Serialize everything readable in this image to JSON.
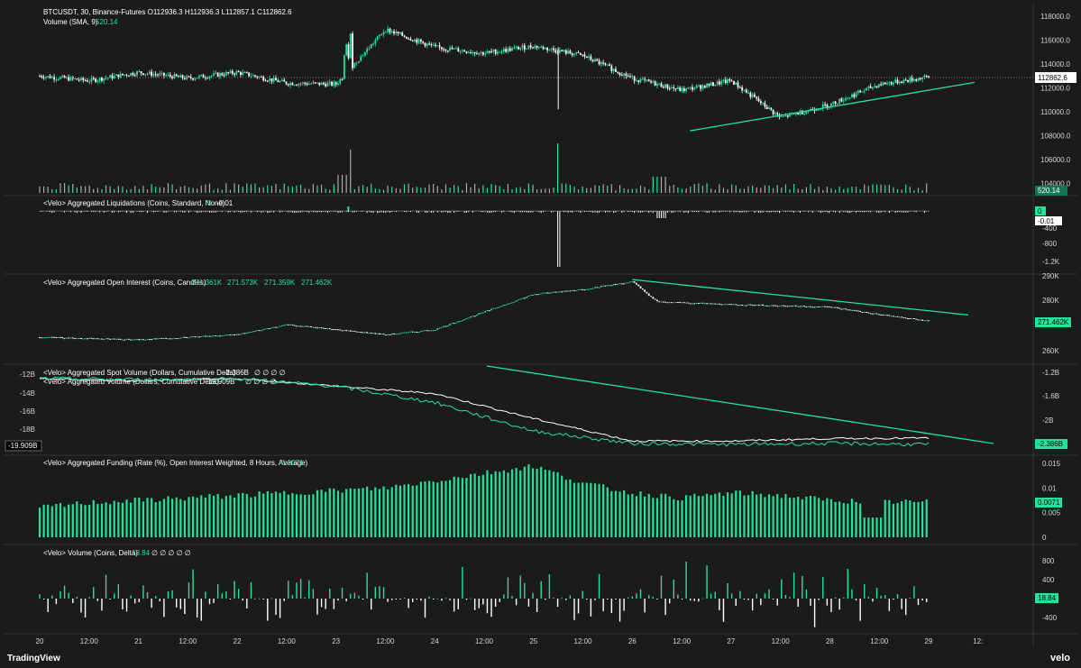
{
  "colors": {
    "bg": "#1b1b1b",
    "up": "#22e39a",
    "down": "#ffffff",
    "grid": "#2a2a2a",
    "text": "#d1d4dc",
    "accent": "#22e39a",
    "dark_badge": "#000000"
  },
  "price_panel": {
    "header": "BTCUSDT, 30, Binance-Futures",
    "ohlc": "O112936.3  H112936.3  L112857.1  C112862.6",
    "volume_label": "Volume (SMA, 9)",
    "volume_value": "520.14",
    "last_price": "112862.6"
  },
  "liq_panel": {
    "title": "<Velo> Aggregated Liquidations (Coins, Standard, None)",
    "v1": "0",
    "v2": "-0.01",
    "badge_top": "0",
    "badge_bottom": "-0.01"
  },
  "oi_panel": {
    "title": "<Velo> Aggregated Open Interest (Coins, Candles)",
    "v1": "271.361K",
    "v2": "271.573K",
    "v3": "271.359K",
    "v4": "271.462K",
    "badge": "271.462K"
  },
  "cvd_panel": {
    "spot_title": "<Velo> Aggregated Spot Volume (Dollars, Cumulative Delta)",
    "spot_value": "-2.386B",
    "perp_title": "<Velo> Aggregated Volume (Dollars, Cumulative Delta)",
    "perp_value": "-19.909B",
    "null_marks": "∅ ∅ ∅ ∅",
    "left_badge": "-19.909B",
    "right_badge": "-2.386B"
  },
  "funding_panel": {
    "title": "<Velo> Aggregated Funding (Rate (%), Open Interest Weighted, 8 Hours, Average)",
    "value": "0.0071",
    "badge": "0.0071"
  },
  "delta_panel": {
    "title": "<Velo> Volume (Coins, Delta)",
    "value": "18.84",
    "null_marks": "∅ ∅ ∅ ∅ ∅",
    "badge": "18.84"
  },
  "branding": {
    "tv": "TradingView",
    "velo": "velo"
  },
  "chart_data": [
    {
      "type": "candlestick",
      "title": "BTCUSDT, 30, Binance-Futures",
      "y_ticks": [
        "118000.0",
        "116000.0",
        "114000.0",
        "112000.0",
        "110000.0",
        "108000.0",
        "106000.0",
        "104000.0"
      ],
      "ylim": [
        103500,
        118600
      ],
      "x_ticks": [
        "20",
        "12:00",
        "21",
        "12:00",
        "22",
        "12:00",
        "23",
        "12:00",
        "24",
        "12:00",
        "25",
        "12:00",
        "26",
        "12:00",
        "27",
        "12:00",
        "28",
        "12:00",
        "29",
        "12:"
      ],
      "x": [
        0,
        12,
        24,
        36,
        48,
        60,
        72,
        84,
        96,
        108,
        120,
        132,
        144,
        156,
        168,
        180,
        192,
        204,
        216
      ],
      "close": [
        113000,
        112600,
        113300,
        112800,
        113300,
        112400,
        112300,
        116900,
        115400,
        114900,
        115500,
        114700,
        112800,
        111800,
        112600,
        109500,
        110600,
        112300,
        112900
      ],
      "trendline": [
        [
          158,
          108400
        ],
        [
          214,
          112000
        ]
      ],
      "last": 112862.6
    },
    {
      "type": "bar",
      "title": "Volume (SMA, 9)",
      "spikes": [
        {
          "x": 75,
          "value": "large"
        },
        {
          "x": 126,
          "value": "largest"
        }
      ],
      "last": 520.14
    },
    {
      "type": "bar",
      "title": "<Velo> Aggregated Liquidations (Coins, Standard, None)",
      "y_ticks": [
        "-400",
        "-800",
        "-1.2K"
      ],
      "spikes": [
        {
          "x": 126,
          "value": -1300
        },
        {
          "x": 150,
          "value": -200
        }
      ]
    },
    {
      "type": "line",
      "title": "<Velo> Aggregated Open Interest (Coins, Candles)",
      "y_ticks": [
        "290K",
        "280K",
        "260K"
      ],
      "x": [
        0,
        24,
        48,
        60,
        72,
        84,
        96,
        108,
        120,
        132,
        144,
        150,
        168,
        192,
        204,
        216
      ],
      "values": [
        265000,
        264000,
        266000,
        270000,
        268000,
        266000,
        268000,
        275000,
        282000,
        284000,
        287000,
        279000,
        278000,
        277000,
        274000,
        271400
      ],
      "trendline": [
        [
          144,
          287800
        ],
        [
          222,
          273800
        ]
      ],
      "last": 271462
    }
  ],
  "chart_data_extra": [
    {
      "type": "line",
      "title": "Cumulative Delta",
      "y_ticks_left": [
        "-12B",
        "-14B",
        "-16B",
        "-18B"
      ],
      "y_ticks_right": [
        "-1.2B",
        "-1.6B",
        "-2B"
      ],
      "series": [
        {
          "name": "<Velo> Aggregated Spot Volume (Dollars, Cumulative Delta)",
          "values": [
            -1.2,
            -1.25,
            -1.2,
            -1.35,
            -1.5,
            -2.0,
            -2.45,
            -2.45,
            -2.4,
            -2.39
          ]
        },
        {
          "name": "<Velo> Aggregated Volume (Dollars, Cumulative Delta)",
          "values": [
            -13,
            -13.1,
            -13.0,
            -13.8,
            -15.5,
            -18.5,
            -19.8,
            -19.9,
            -19.8,
            -19.9
          ]
        }
      ],
      "trendline": "descending"
    },
    {
      "type": "bar",
      "title": "<Velo> Aggregated Funding (Rate (%), Open Interest Weighted, 8 Hours, Average)",
      "y_ticks": [
        "0.015",
        "0.01",
        "0.005",
        "0"
      ],
      "values": [
        0.006,
        0.007,
        0.0075,
        0.008,
        0.0085,
        0.009,
        0.0095,
        0.01,
        0.0115,
        0.013,
        0.0145,
        0.011,
        0.009,
        0.008,
        0.009,
        0.0085,
        0.0075,
        0.0072,
        0.0071
      ]
    },
    {
      "type": "bar",
      "title": "<Velo> Volume (Coins, Delta)",
      "y_ticks": [
        "800",
        "400",
        "-400"
      ],
      "last": 18.84
    }
  ]
}
